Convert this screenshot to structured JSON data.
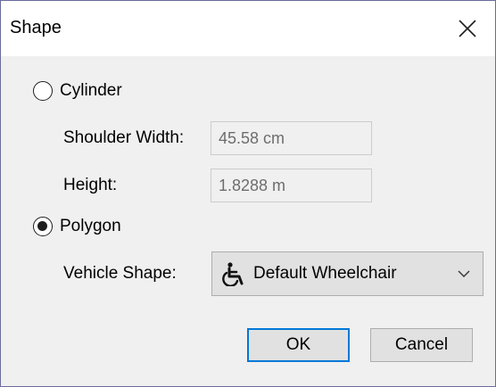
{
  "dialog": {
    "title": "Shape",
    "close_icon": "close-icon"
  },
  "cylinder": {
    "label": "Cylinder",
    "selected": false,
    "shoulder_width_label": "Shoulder Width:",
    "shoulder_width_value": "45.58 cm",
    "height_label": "Height:",
    "height_value": "1.8288 m"
  },
  "polygon": {
    "label": "Polygon",
    "selected": true,
    "vehicle_shape_label": "Vehicle Shape:",
    "vehicle_shape_value": "Default Wheelchair",
    "vehicle_shape_icon": "wheelchair-icon"
  },
  "buttons": {
    "ok_label": "OK",
    "cancel_label": "Cancel"
  },
  "colors": {
    "accent": "#0078d7",
    "window_border": "#6b6b9c"
  }
}
